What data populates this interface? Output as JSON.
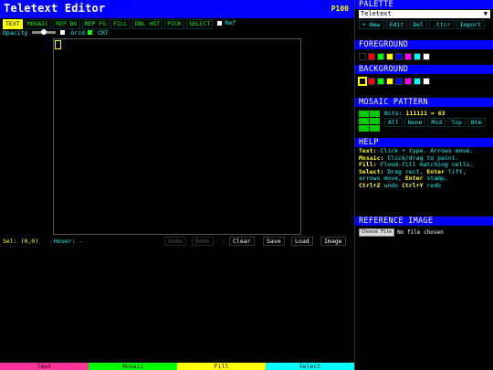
{
  "header": {
    "title": "Teletext Editor",
    "page_number": "P100"
  },
  "toolbar": {
    "tools": [
      "TEXT",
      "MOSAIC",
      "REP BG",
      "REP FG",
      "FILL",
      "DBL HGT",
      "PICK",
      "SELECT"
    ],
    "ref_label": "Ref",
    "opacity_label": "Opacity",
    "grid_label": "Grid",
    "crt_label": "CRT",
    "opacity_value": 0.5
  },
  "status": {
    "sel": "Sel: (0,0)",
    "hover": "Hover: -",
    "undo": "Undo",
    "redo": "Redo",
    "clear": "Clear",
    "save": "Save",
    "load": "Load",
    "image": "Image"
  },
  "sidebar": {
    "palette_head": "PALETTE",
    "palette_select": "Teletext",
    "palette_actions": [
      "+ New",
      "Edit",
      "Del",
      ".ttcr",
      "Import"
    ],
    "foreground_head": "FOREGROUND",
    "background_head": "BACKGROUND",
    "colors": [
      "#000000",
      "#ff0000",
      "#00ff00",
      "#ffff00",
      "#0000ff",
      "#ff00ff",
      "#00ffff",
      "#ffffff"
    ],
    "mosaic_head": "MOSAIC PATTERN",
    "bits_label": "Bits:",
    "bits_value": "111111 = 63",
    "mosaic_actions": [
      "All",
      "None",
      "Mid",
      "Top",
      "Btm"
    ],
    "help_head": "HELP",
    "help": {
      "text_k": "Text:",
      "text_v": " Click + type. Arrows move.",
      "mosaic_k": "Mosaic:",
      "mosaic_v": " Click/drag to paint.",
      "fill_k": "Fill:",
      "fill_v": " Flood-fill matching cells.",
      "select_k": "Select:",
      "select_v": " Drag rect, ",
      "enter1": "Enter",
      "select_v2": " lift, arrows move, ",
      "enter2": "Enter",
      "select_v3": " stamp.",
      "undo_k": "Ctrl+Z",
      "undo_v": " undo  ",
      "redo_k": "Ctrl+Y",
      "redo_v": " redo"
    },
    "reference_head": "REFERENCE IMAGE",
    "choose_file": "Choose File",
    "no_file": "No file chosen"
  },
  "modebar": [
    {
      "label": "Text",
      "color": "#ff3399"
    },
    {
      "label": "Mosaic",
      "color": "#00ff00"
    },
    {
      "label": "Fill",
      "color": "#ffff00"
    },
    {
      "label": "Select",
      "color": "#00ffff"
    }
  ]
}
